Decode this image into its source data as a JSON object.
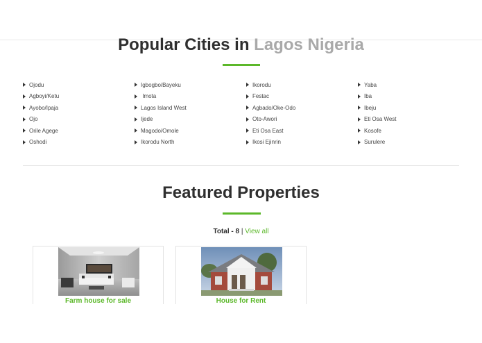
{
  "cities": {
    "title_main": "Popular Cities in",
    "title_accent": "Lagos Nigeria",
    "columns": [
      [
        "Ojodu",
        "Agboyi/Ketu",
        "Ayobo/Ipaja",
        "Ojo",
        "Orile Agege",
        "Oshodi"
      ],
      [
        "Igbogbo/Bayeku",
        " Imota",
        "Lagos Island West",
        "Ijede",
        "Magodo/Omole",
        "Ikorodu North"
      ],
      [
        "Ikorodu",
        "Festac",
        "Agbado/Oke-Odo",
        "Oto-Awori",
        "Eti Osa East",
        "Ikosi Ejinrin"
      ],
      [
        "Yaba",
        "Iba",
        "Ibeju",
        "Eti Osa West",
        "Kosofe",
        "Surulere"
      ]
    ]
  },
  "featured": {
    "title": "Featured Properties",
    "total_label": "Total - 8",
    "separator": "|",
    "view_all": "View all",
    "cards": [
      {
        "title": "Farm house for sale"
      },
      {
        "title": "House for Rent"
      }
    ]
  },
  "colors": {
    "accent_green": "#5cb82a",
    "title_dark": "#2f2f2f",
    "title_gray": "#a9a9a9"
  },
  "icons": {
    "list_bullet": "caret-right-icon"
  }
}
